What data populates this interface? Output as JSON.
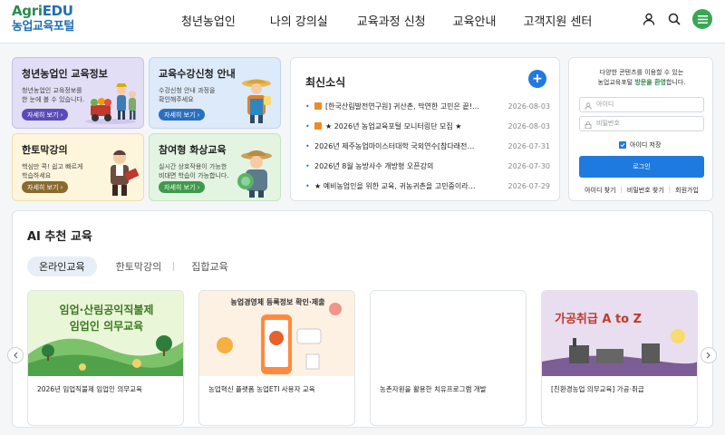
{
  "header": {
    "logo_line1_a": "Agri",
    "logo_line1_b": "EDU",
    "logo_line2": "농업교육포털",
    "nav": [
      "청년농업인",
      "나의 강의실",
      "교육과정 신청",
      "교육안내",
      "고객지원 센터"
    ],
    "icons": [
      "user-icon",
      "search-icon",
      "menu-icon"
    ]
  },
  "banners": [
    {
      "title": "청년농업인 교육정보",
      "desc": "청년농업인 교육정보를\n한 눈에 볼 수 있습니다.",
      "more": "자세히 보기"
    },
    {
      "title": "교육수강신청 안내",
      "desc": "수강신청 안내 과정을\n확인해주세요",
      "more": "자세히 보기"
    },
    {
      "title": "한토막강의",
      "desc": "핵심만 콕! 쉽고 빠르게\n학습하세요",
      "more": "자세히 보기"
    },
    {
      "title": "참여형 화상교육",
      "desc": "실시간 상호작용이 가능한\n비대면 학습이 가능합니다.",
      "more": "자세히 보기"
    }
  ],
  "news": {
    "title": "최신소식",
    "items": [
      {
        "text": "[한국산림발전연구원] 귀산촌, 막연한 고민은 끝!…",
        "date": "2026-08-03",
        "badge": true
      },
      {
        "text": "★ 2026년 농업교육포털 모니터링단 모집 ★",
        "date": "2026-08-03",
        "badge": true
      },
      {
        "text": "2026년 제주농업마이스터대학 국외연수[참다래전…",
        "date": "2026-07-31",
        "badge": false
      },
      {
        "text": "2026년 8월 농방사수 개방형 오픈강의",
        "date": "2026-07-30",
        "badge": false
      },
      {
        "text": "★ 예비농업인을 위한 교육, 귀농귀촌을 고민중이라…",
        "date": "2026-07-29",
        "badge": false
      }
    ]
  },
  "login": {
    "intro_line1": "다양한 콘텐츠를 이용할 수 있는",
    "intro_line2_a": "농업교육포털 ",
    "intro_line2_b": "방문을 환영",
    "intro_line2_c": "합니다.",
    "id_placeholder": "아이디",
    "pw_placeholder": "비밀번호",
    "keep_label": "아이디 저장",
    "button": "로그인",
    "links": [
      "아이디 찾기",
      "비밀번호 찾기",
      "회원가입"
    ]
  },
  "ai": {
    "title": "AI 추천 교육",
    "tabs": [
      "온라인교육",
      "한토막강의",
      "집합교육"
    ],
    "active_tab": 0,
    "cards": [
      {
        "thumb_title_1": "임업·산림공익직불제",
        "thumb_title_2": "임업인 의무교육",
        "caption": "2026년 임업직불제 임업인 의무교육"
      },
      {
        "thumb_title_1": "농업경영체 등록정보 확인·제출",
        "caption": "농업혁신 플랫폼 농업ETI 사용자 교육"
      },
      {
        "caption": "농촌자원을 활용한 치유프로그램 개발"
      },
      {
        "thumb_title_1": "가공취급 A to Z",
        "caption": "[친환경농업 의무교육] 가공·취급"
      }
    ]
  },
  "colors": {
    "accent": "#1f7ae0",
    "brand_green": "#2d8a4e",
    "brand_blue": "#1f6fb5"
  }
}
